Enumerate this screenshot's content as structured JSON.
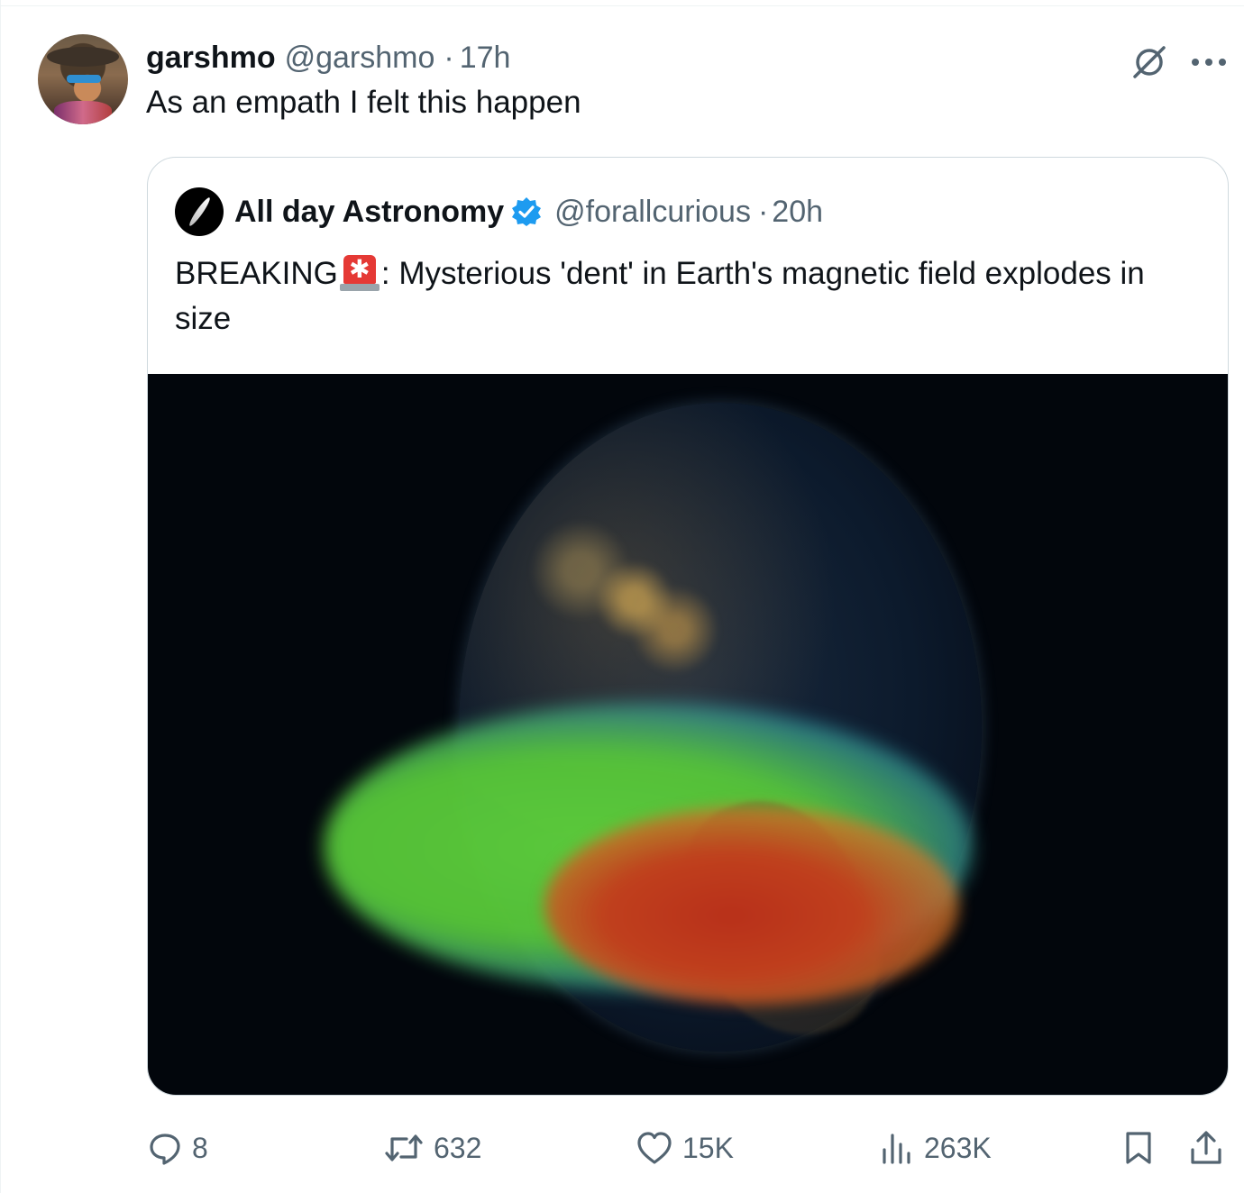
{
  "tweet": {
    "author_name": "garshmo",
    "author_handle": "@garshmo",
    "separator": "·",
    "time": "17h",
    "text": "As an empath I felt this happen",
    "grok_icon": "slashed-circle-icon",
    "more_icon": "ellipsis-icon"
  },
  "quoted": {
    "author_name": "All day Astronomy",
    "author_handle": "@forallcurious",
    "separator": "·",
    "time": "20h",
    "verified": true,
    "verified_color": "#1d9bf0",
    "text_before": "BREAKING",
    "emoji": "police-siren-icon",
    "text_after": ": Mysterious 'dent' in Earth's magnetic field explodes in size",
    "media_alt": "earth-magnetic-anomaly-image"
  },
  "actions": {
    "replies": "8",
    "reposts": "632",
    "likes": "15K",
    "views": "263K"
  },
  "colors": {
    "text": "#0f1419",
    "muted": "#536471",
    "border": "#cfd9de",
    "accent": "#1d9bf0"
  }
}
